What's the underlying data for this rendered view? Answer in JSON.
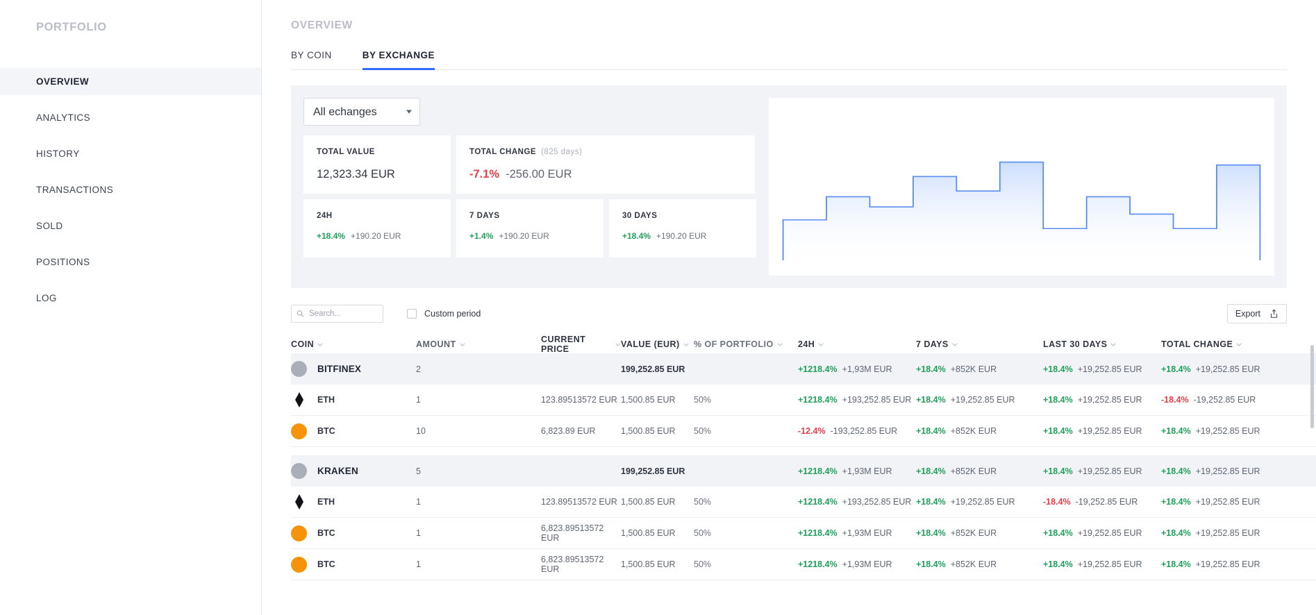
{
  "sidebar": {
    "title": "PORTFOLIO",
    "items": [
      {
        "label": "OVERVIEW",
        "active": true
      },
      {
        "label": "ANALYTICS",
        "active": false
      },
      {
        "label": "HISTORY",
        "active": false
      },
      {
        "label": "TRANSACTIONS",
        "active": false
      },
      {
        "label": "SOLD",
        "active": false
      },
      {
        "label": "POSITIONS",
        "active": false
      },
      {
        "label": "LOG",
        "active": false
      }
    ]
  },
  "page": {
    "title": "OVERVIEW"
  },
  "tabs": [
    {
      "label": "BY COIN",
      "active": false
    },
    {
      "label": "BY EXCHANGE",
      "active": true
    }
  ],
  "filter": {
    "selected": "All echanges",
    "options": [
      "All echanges",
      "Bitfinex",
      "Kraken"
    ]
  },
  "summary": {
    "total_value": {
      "label": "TOTAL VALUE",
      "value": "12,323.34 EUR"
    },
    "total_change": {
      "label": "TOTAL CHANGE",
      "period": "(825 days)",
      "pct": "-7.1%",
      "pct_dir": "down",
      "amount": "-256.00 EUR"
    },
    "periods": [
      {
        "label": "24H",
        "pct": "+18.4%",
        "pct_dir": "up",
        "amount": "+190.20 EUR"
      },
      {
        "label": "7 DAYS",
        "pct": "+1.4%",
        "pct_dir": "up",
        "amount": "+190.20 EUR"
      },
      {
        "label": "30 DAYS",
        "pct": "+18.4%",
        "pct_dir": "up",
        "amount": "+190.20 EUR"
      }
    ]
  },
  "chart_data": {
    "type": "area",
    "title": "",
    "xlabel": "",
    "ylabel": "",
    "grid": false,
    "legend": "none",
    "step": true,
    "line_color": "#5b8def",
    "fill_top": "#c9dcff",
    "fill_bottom": "#ffffff",
    "x": [
      0,
      1,
      2,
      3,
      4,
      5,
      6,
      7,
      8,
      9,
      10
    ],
    "values": [
      28,
      44,
      37,
      58,
      48,
      68,
      22,
      44,
      32,
      22,
      66
    ],
    "ylim": [
      0,
      100
    ]
  },
  "toolbar": {
    "search_placeholder": "Search...",
    "search_value": "",
    "custom_period_label": "Custom period",
    "custom_period_checked": false,
    "export_label": "Export"
  },
  "table": {
    "columns": [
      "COIN",
      "AMOUNT",
      "CURRENT PRICE",
      "VALUE (EUR)",
      "% OF PORTFOLIO",
      "24H",
      "7 DAYS",
      "LAST 30 DAYS",
      "TOTAL CHANGE"
    ],
    "groups": [
      {
        "name": "BITFINEX",
        "icon": "exchange-avatar",
        "amount": "2",
        "price": "",
        "value": "199,252.85 EUR",
        "portfolio_pct": "",
        "d24": {
          "pct": "+1218.4%",
          "dir": "up",
          "amount": "+1,93M EUR"
        },
        "d7": {
          "pct": "+18.4%",
          "dir": "up",
          "amount": "+852K EUR"
        },
        "d30": {
          "pct": "+18.4%",
          "dir": "up",
          "amount": "+19,252.85 EUR"
        },
        "total": {
          "pct": "+18.4%",
          "dir": "up",
          "amount": "+19,252.85 EUR"
        },
        "rows": [
          {
            "coin": "ETH",
            "icon": "eth-diamond-icon",
            "amount": "1",
            "price": "123.89513572 EUR",
            "value": "1,500.85 EUR",
            "portfolio_pct": "50%",
            "d24": {
              "pct": "+1218.4%",
              "dir": "up",
              "amount": "+193,252.85 EUR"
            },
            "d7": {
              "pct": "+18.4%",
              "dir": "up",
              "amount": "+19,252.85 EUR"
            },
            "d30": {
              "pct": "+18.4%",
              "dir": "up",
              "amount": "+19,252.85 EUR"
            },
            "total": {
              "pct": "-18.4%",
              "dir": "down",
              "amount": "-19,252.85 EUR"
            }
          },
          {
            "coin": "BTC",
            "icon": "btc-circle-icon",
            "amount": "10",
            "price": "6,823.89 EUR",
            "value": "1,500.85 EUR",
            "portfolio_pct": "50%",
            "d24": {
              "pct": "-12.4%",
              "dir": "down",
              "amount": "-193,252.85 EUR"
            },
            "d7": {
              "pct": "+18.4%",
              "dir": "up",
              "amount": "+852K EUR"
            },
            "d30": {
              "pct": "+18.4%",
              "dir": "up",
              "amount": "+19,252.85 EUR"
            },
            "total": {
              "pct": "+18.4%",
              "dir": "up",
              "amount": "+19,252.85 EUR"
            }
          }
        ]
      },
      {
        "name": "KRAKEN",
        "icon": "exchange-avatar",
        "amount": "5",
        "price": "",
        "value": "199,252.85 EUR",
        "portfolio_pct": "",
        "d24": {
          "pct": "+1218.4%",
          "dir": "up",
          "amount": "+1,93M EUR"
        },
        "d7": {
          "pct": "+18.4%",
          "dir": "up",
          "amount": "+852K EUR"
        },
        "d30": {
          "pct": "+18.4%",
          "dir": "up",
          "amount": "+19,252.85 EUR"
        },
        "total": {
          "pct": "+18.4%",
          "dir": "up",
          "amount": "+19,252.85 EUR"
        },
        "rows": [
          {
            "coin": "ETH",
            "icon": "eth-diamond-icon",
            "amount": "1",
            "price": "123.89513572 EUR",
            "value": "1,500.85 EUR",
            "portfolio_pct": "50%",
            "d24": {
              "pct": "+1218.4%",
              "dir": "up",
              "amount": "+193,252.85 EUR"
            },
            "d7": {
              "pct": "+18.4%",
              "dir": "up",
              "amount": "+19,252.85 EUR"
            },
            "d30": {
              "pct": "-18.4%",
              "dir": "down",
              "amount": "-19,252.85 EUR"
            },
            "total": {
              "pct": "+18.4%",
              "dir": "up",
              "amount": "+19,252.85 EUR"
            }
          },
          {
            "coin": "BTC",
            "icon": "btc-circle-icon",
            "amount": "1",
            "price": "6,823.89513572 EUR",
            "value": "1,500.85 EUR",
            "portfolio_pct": "50%",
            "d24": {
              "pct": "+1218.4%",
              "dir": "up",
              "amount": "+1,93M EUR"
            },
            "d7": {
              "pct": "+18.4%",
              "dir": "up",
              "amount": "+852K EUR"
            },
            "d30": {
              "pct": "+18.4%",
              "dir": "up",
              "amount": "+19,252.85 EUR"
            },
            "total": {
              "pct": "+18.4%",
              "dir": "up",
              "amount": "+19,252.85 EUR"
            }
          },
          {
            "coin": "BTC",
            "icon": "btc-circle-icon",
            "amount": "1",
            "price": "6,823.89513572 EUR",
            "value": "1,500.85 EUR",
            "portfolio_pct": "50%",
            "d24": {
              "pct": "+1218.4%",
              "dir": "up",
              "amount": "+1,93M EUR"
            },
            "d7": {
              "pct": "+18.4%",
              "dir": "up",
              "amount": "+852K EUR"
            },
            "d30": {
              "pct": "+18.4%",
              "dir": "up",
              "amount": "+19,252.85 EUR"
            },
            "total": {
              "pct": "+18.4%",
              "dir": "up",
              "amount": "+19,252.85 EUR"
            }
          }
        ]
      }
    ]
  },
  "colors": {
    "accent": "#2f6bff",
    "up": "#21a05a",
    "down": "#e8404a",
    "panel_bg": "#f1f3f7",
    "btc": "#f5930a"
  }
}
